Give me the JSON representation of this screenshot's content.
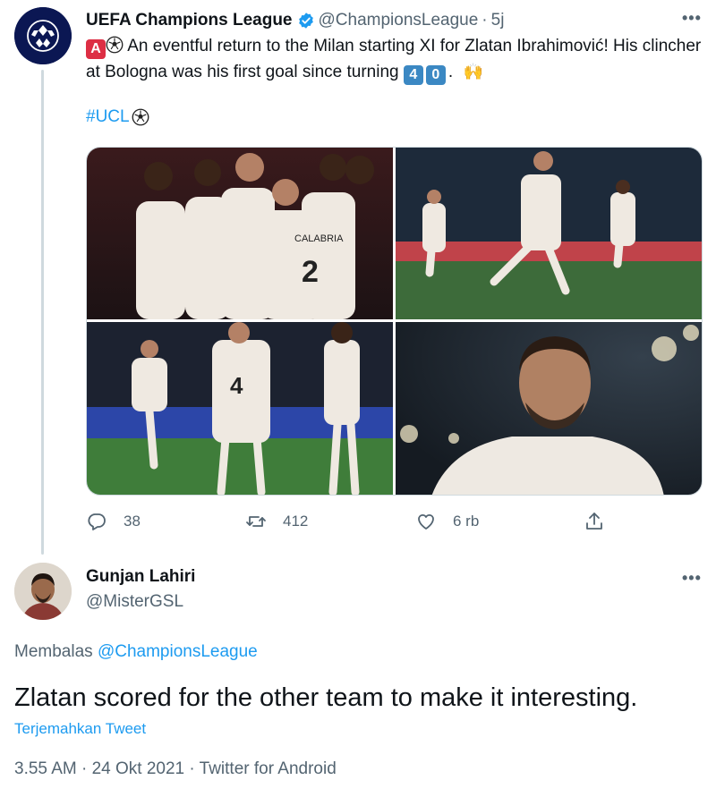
{
  "parent_tweet": {
    "author_name": "UEFA Champions League",
    "handle": "@ChampionsLeague",
    "separator": "·",
    "time": "5j",
    "badge_letter": "A",
    "text": "An eventful return to the Milan starting XI for Zlatan Ibrahimović! His clincher at Bologna was his first goal since turning",
    "age_digits": [
      "4",
      "0"
    ],
    "text_end": ".",
    "hashtag": "#UCL",
    "stats": {
      "replies": "38",
      "retweets": "412",
      "likes": "6 rb"
    },
    "icons": [
      "more-icon",
      "verified-icon",
      "soccer-ball-icon",
      "raised-hands-icon",
      "reply-icon",
      "retweet-icon",
      "like-icon",
      "share-icon"
    ]
  },
  "reply_tweet": {
    "author_name": "Gunjan Lahiri",
    "handle": "@MisterGSL",
    "replying_prefix": "Membalas",
    "replying_to": "@ChampionsLeague",
    "text": "Zlatan scored for the other team to make it interesting.",
    "translate_label": "Terjemahkan Tweet",
    "meta": "3.55 AM · 24 Okt 2021 · Twitter for Android"
  },
  "colors": {
    "link": "#1d9bf0",
    "secondary_text": "#536471",
    "primary_text": "#0f1419",
    "keycap_red": "#dd2e44",
    "keycap_blue": "#3b88c3",
    "thread_line": "#cfd9de"
  }
}
